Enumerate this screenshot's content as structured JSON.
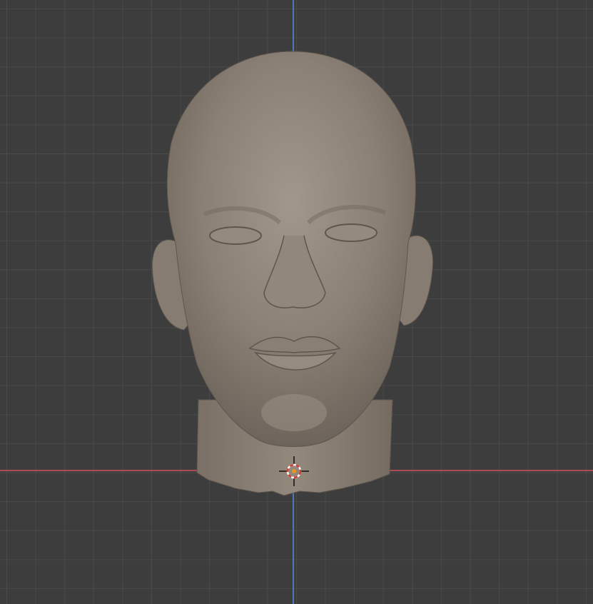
{
  "viewport": {
    "name": "3D Viewport",
    "background_color": "#3d3d3d",
    "grid_color": "#4a4a4a",
    "x_axis_color": "#b04a55",
    "y_axis_color": "#4f78b8",
    "object": "sculpted-head-mesh",
    "mesh_color": "#8b8075",
    "cursor": "3d-cursor-icon"
  }
}
